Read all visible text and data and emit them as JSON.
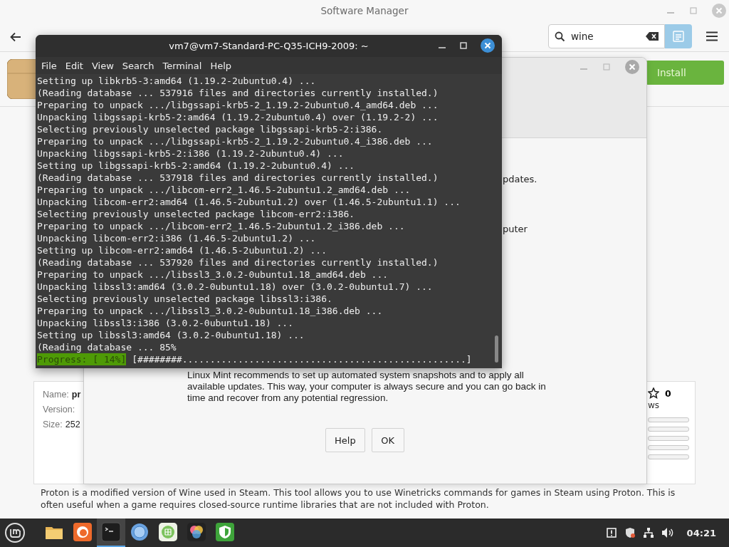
{
  "software_manager": {
    "title": "Software Manager",
    "search": {
      "value": "wine"
    },
    "install_button": "Install",
    "details": {
      "name_label": "Name:",
      "name_value": "pr",
      "version_label": "Version:",
      "size_label": "Size:",
      "size_value": "252"
    },
    "rating": {
      "count": "0",
      "reviews_fragment": "ws"
    },
    "description": "Proton is a modified version of Wine used in Steam. This tool allows you to use Winetricks commands for games in Steam using Proton. This is often useful when a game requires closed-source runtime libraries that are not included with Proton."
  },
  "dialog": {
    "fragments": [
      "pdates.",
      "puter"
    ],
    "message_lines": [
      "Linux Mint recommends to set up automated system snapshots and to apply all",
      "available updates. This way, your computer is always secure and you can go back in",
      "time and recover from any potential regression."
    ],
    "buttons": [
      "Help",
      "OK"
    ]
  },
  "terminal": {
    "title": "vm7@vm7-Standard-PC-Q35-ICH9-2009: ~",
    "menu": [
      "File",
      "Edit",
      "View",
      "Search",
      "Terminal",
      "Help"
    ],
    "lines": [
      "Setting up libkrb5-3:amd64 (1.19.2-2ubuntu0.4) ...",
      "(Reading database ... 537916 files and directories currently installed.)",
      "Preparing to unpack .../libgssapi-krb5-2_1.19.2-2ubuntu0.4_amd64.deb ...",
      "Unpacking libgssapi-krb5-2:amd64 (1.19.2-2ubuntu0.4) over (1.19.2-2) ...",
      "Selecting previously unselected package libgssapi-krb5-2:i386.",
      "Preparing to unpack .../libgssapi-krb5-2_1.19.2-2ubuntu0.4_i386.deb ...",
      "Unpacking libgssapi-krb5-2:i386 (1.19.2-2ubuntu0.4) ...",
      "Setting up libgssapi-krb5-2:amd64 (1.19.2-2ubuntu0.4) ...",
      "(Reading database ... 537918 files and directories currently installed.)",
      "Preparing to unpack .../libcom-err2_1.46.5-2ubuntu1.2_amd64.deb ...",
      "Unpacking libcom-err2:amd64 (1.46.5-2ubuntu1.2) over (1.46.5-2ubuntu1.1) ...",
      "Selecting previously unselected package libcom-err2:i386.",
      "Preparing to unpack .../libcom-err2_1.46.5-2ubuntu1.2_i386.deb ...",
      "Unpacking libcom-err2:i386 (1.46.5-2ubuntu1.2) ...",
      "Setting up libcom-err2:amd64 (1.46.5-2ubuntu1.2) ...",
      "(Reading database ... 537920 files and directories currently installed.)",
      "Preparing to unpack .../libssl3_3.0.2-0ubuntu1.18_amd64.deb ...",
      "Unpacking libssl3:amd64 (3.0.2-0ubuntu1.18) over (3.0.2-0ubuntu1.7) ...",
      "Selecting previously unselected package libssl3:i386.",
      "Preparing to unpack .../libssl3_3.0.2-0ubuntu1.18_i386.deb ...",
      "Unpacking libssl3:i386 (3.0.2-0ubuntu1.18) ...",
      "Setting up libssl3:amd64 (3.0.2-0ubuntu1.18) ...",
      "(Reading database ... 85%"
    ],
    "progress_label": "Progress: [ 14%]",
    "progress_bar": "[########...................................................]"
  },
  "taskbar": {
    "apps": [
      {
        "kind": "folder",
        "selected": false
      },
      {
        "kind": "firefox",
        "selected": false
      },
      {
        "kind": "terminal",
        "selected": true
      },
      {
        "kind": "browser",
        "selected": false
      },
      {
        "kind": "grid",
        "selected": false
      },
      {
        "kind": "colors",
        "selected": false
      },
      {
        "kind": "shield",
        "selected": false
      }
    ],
    "clock": "04:21"
  }
}
